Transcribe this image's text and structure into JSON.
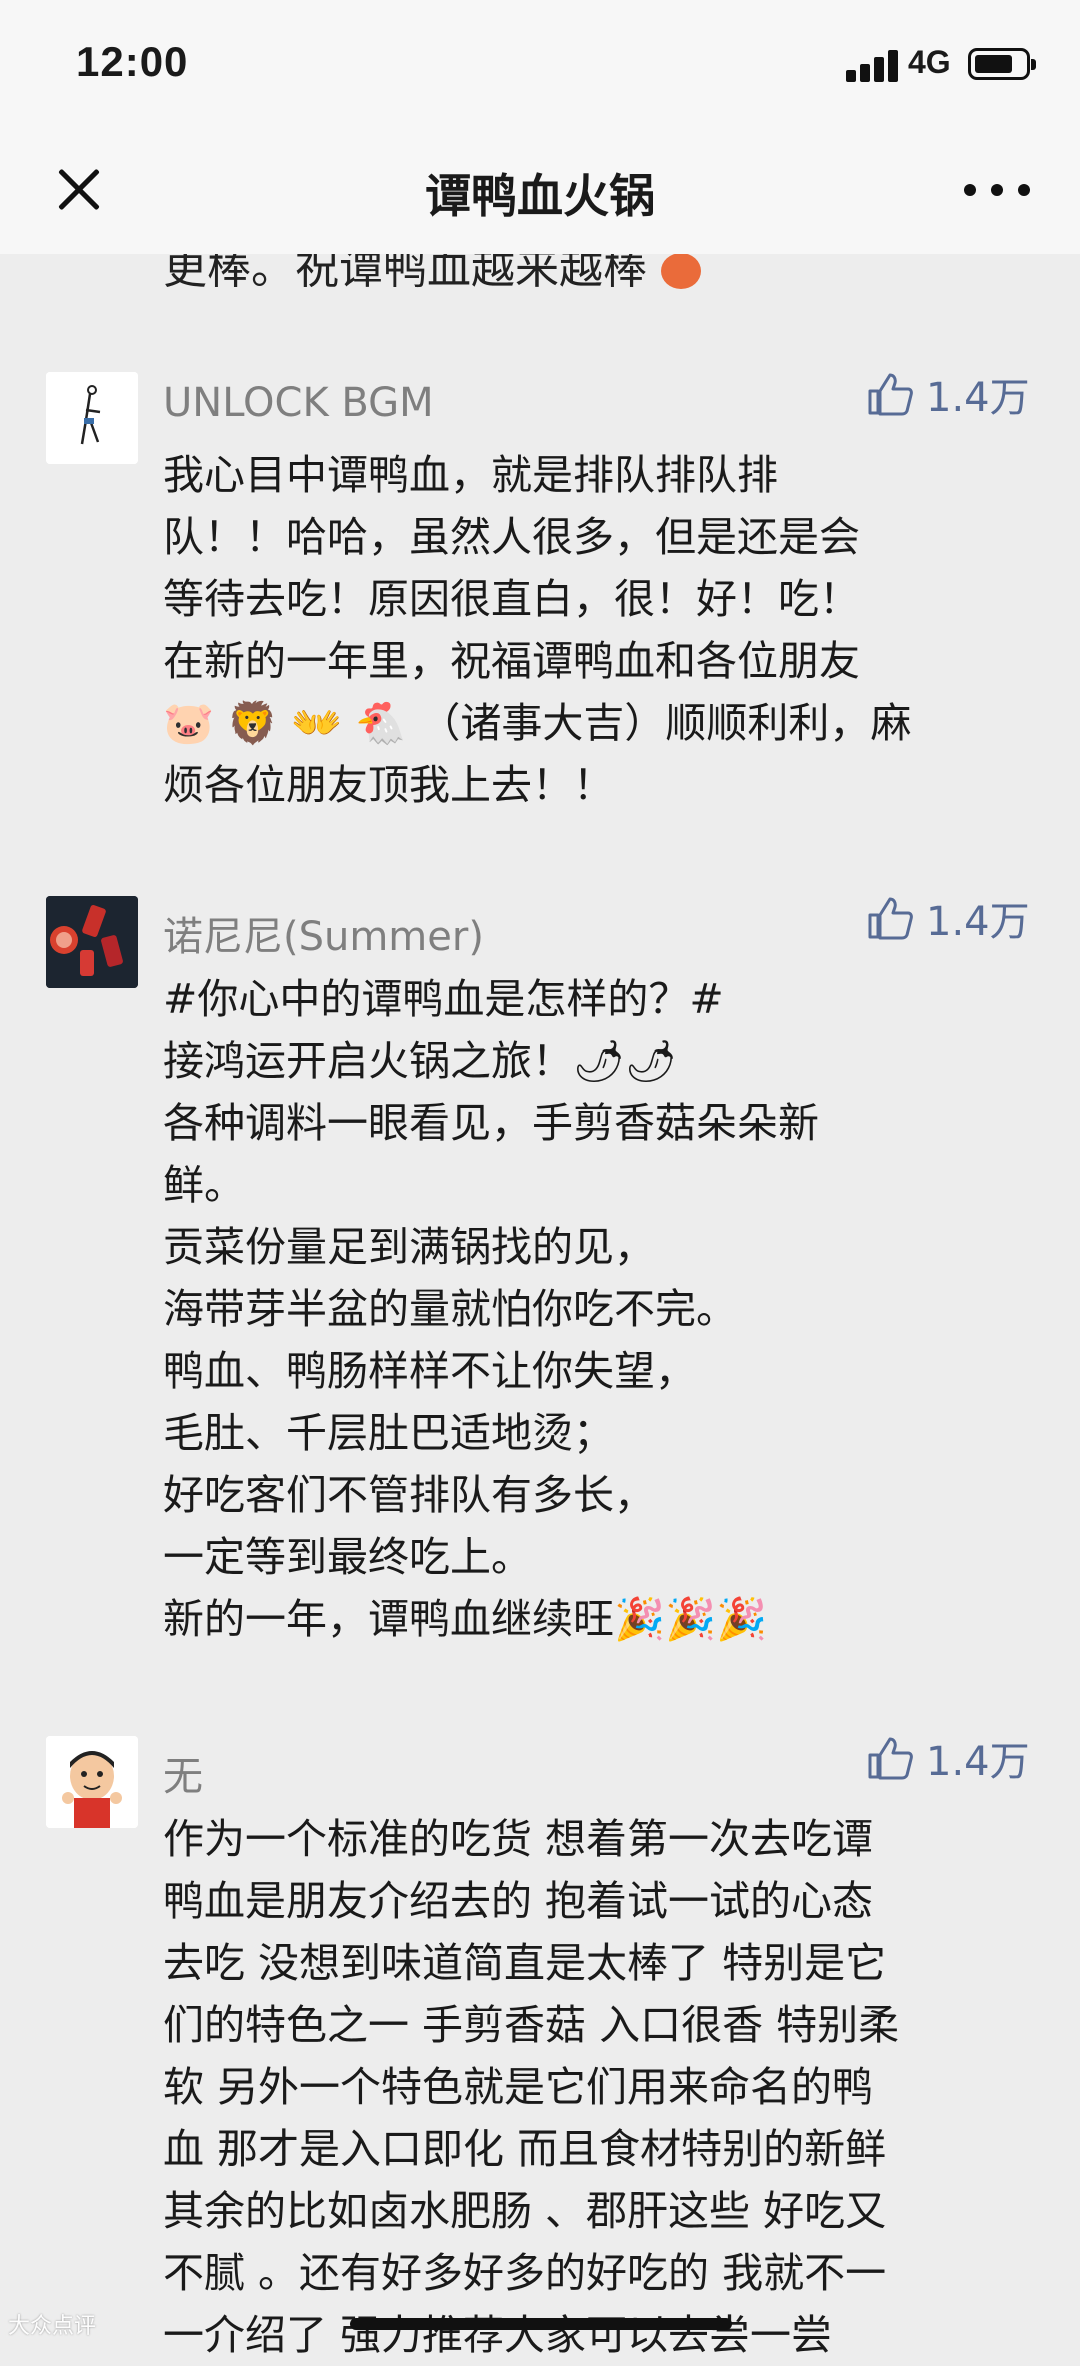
{
  "status_bar": {
    "time": "12:00",
    "network": "4G"
  },
  "nav": {
    "title": "谭鸭血火锅"
  },
  "clipped_previous": {
    "text": "更棒。祝谭鸭血越来越棒"
  },
  "comments": [
    {
      "username": "UNLOCK BGM",
      "likes": "1.4万",
      "text": "我心目中谭鸭血，就是排队排队排\n队！！哈哈，虽然人很多，但是还是会\n等待去吃！原因很直白，很！好！吃！\n在新的一年里，祝福谭鸭血和各位朋友\n🐷 🦁 👐 🐔 （诸事大吉）顺顺利利，麻\n烦各位朋友顶我上去！！"
    },
    {
      "username": "诺尼尼(Summer)",
      "likes": "1.4万",
      "text": "#你心中的谭鸭血是怎样的？#\n接鸿运开启火锅之旅！🌶🌶\n各种调料一眼看见，手剪香菇朵朵新\n鲜。\n贡菜份量足到满锅找的见，\n海带芽半盆的量就怕你吃不完。\n鸭血、鸭肠样样不让你失望，\n毛肚、千层肚巴适地烫；\n好吃客们不管排队有多长，\n一定等到最终吃上。\n新的一年，谭鸭血继续旺🎉🎉🎉"
    },
    {
      "username": "无",
      "likes": "1.4万",
      "text": "作为一个标准的吃货 想着第一次去吃谭\n鸭血是朋友介绍去的 抱着试一试的心态\n去吃 没想到味道简直是太棒了 特别是它\n们的特色之一 手剪香菇 入口很香 特别柔\n软 另外一个特色就是它们用来命名的鸭\n血 那才是入口即化 而且食材特别的新鲜\n其余的比如卤水肥肠 、郡肝这些 好吃又\n不腻 。还有好多好多的好吃的 我就不一\n一介绍了 强力推荐大家可以去尝一尝"
    }
  ],
  "watermark": "大众点评"
}
